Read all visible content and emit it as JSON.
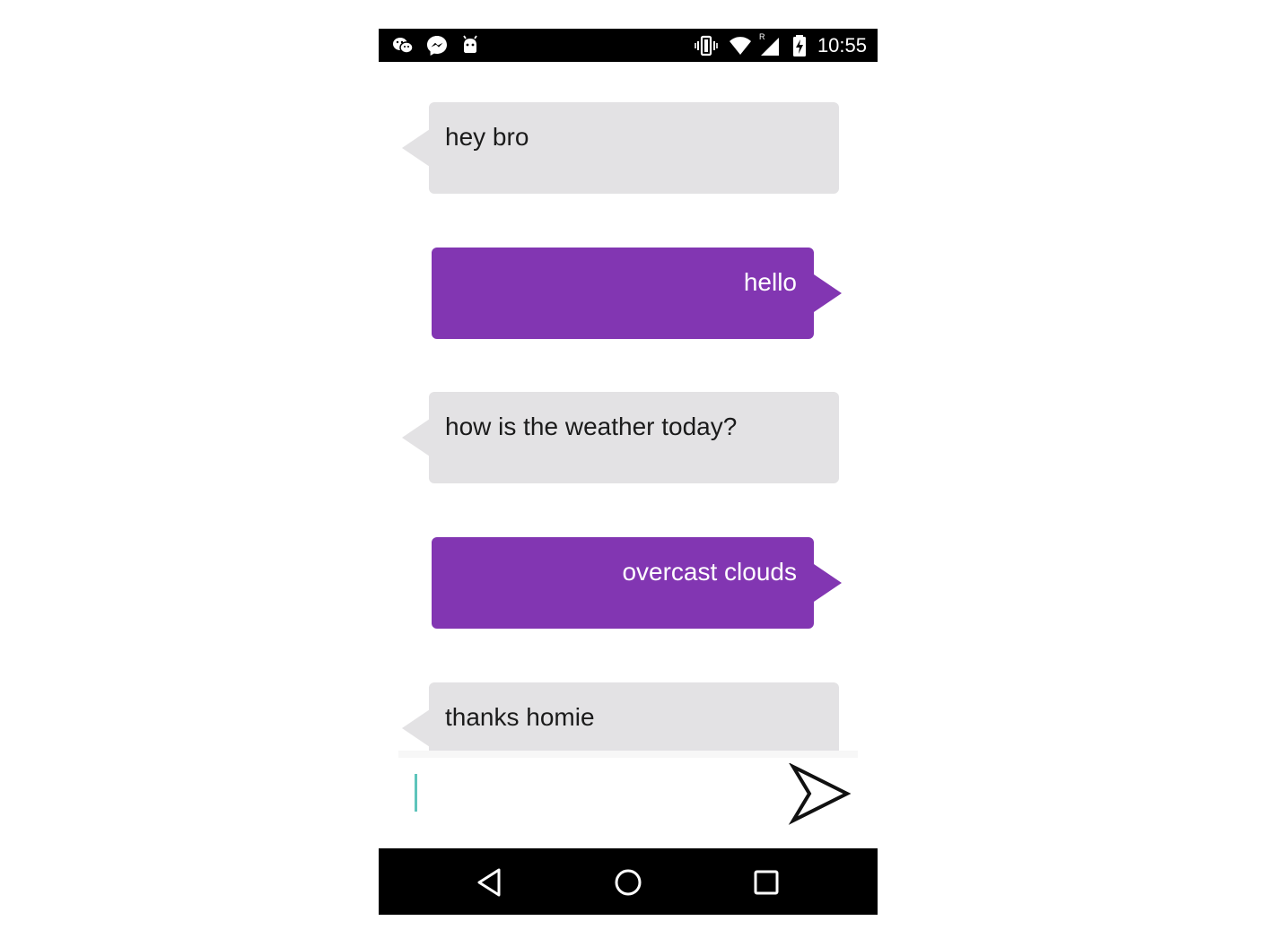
{
  "status_bar": {
    "time": "10:55",
    "left_icons": [
      "wechat-icon",
      "messenger-icon",
      "android-debug-icon"
    ],
    "right_icons": [
      "vibrate-icon",
      "wifi-icon",
      "signal-icon",
      "battery-charging-icon"
    ],
    "roaming_indicator": "R"
  },
  "messages": [
    {
      "direction": "incoming",
      "text": "hey bro"
    },
    {
      "direction": "outgoing",
      "text": "hello"
    },
    {
      "direction": "incoming",
      "text": "how is the weather today?"
    },
    {
      "direction": "outgoing",
      "text": "overcast clouds"
    },
    {
      "direction": "incoming",
      "text": "thanks homie"
    }
  ],
  "composer": {
    "value": "",
    "placeholder": "",
    "send_icon": "send-icon"
  },
  "nav_bar": {
    "buttons": [
      "back-icon",
      "home-icon",
      "recents-icon"
    ]
  },
  "colors": {
    "incoming_bubble": "#e3e2e4",
    "outgoing_bubble": "#8236b2",
    "caret": "#5ec4bb"
  }
}
